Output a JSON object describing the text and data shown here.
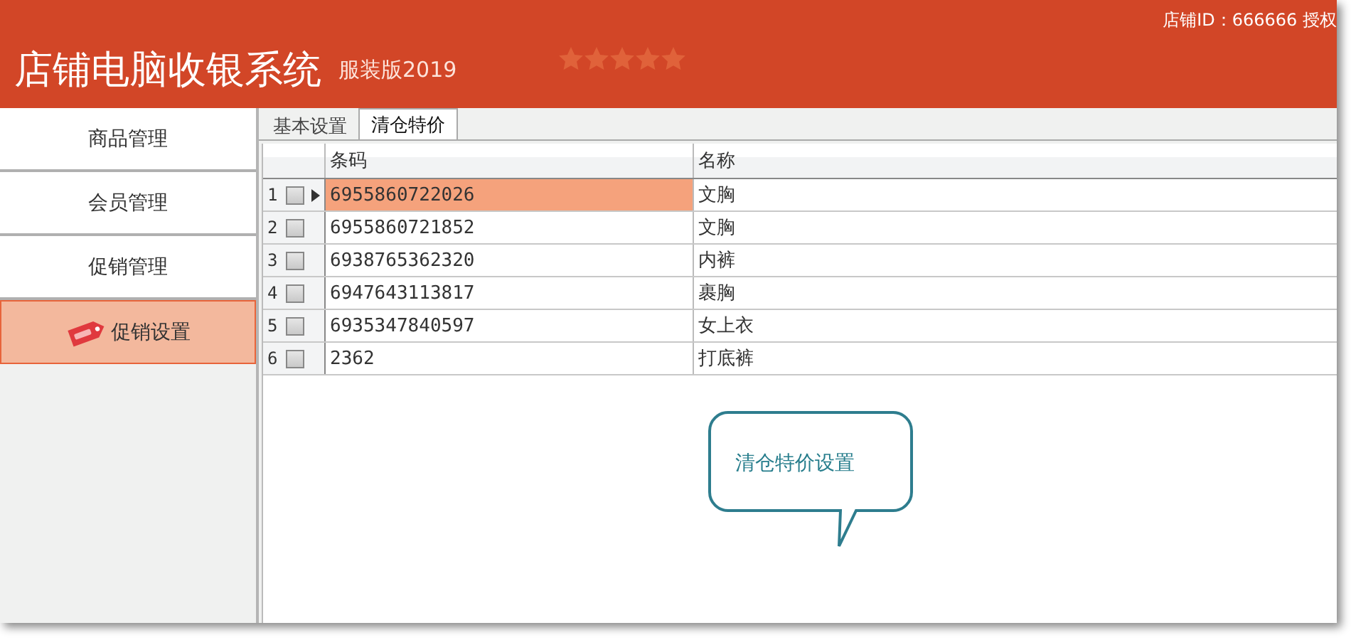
{
  "header": {
    "title": "店铺电脑收银系统",
    "edition": "服装版2019",
    "stars": 5,
    "store_info": "店铺ID：666666 授权"
  },
  "sidebar": {
    "items": [
      {
        "label": "商品管理",
        "selected": false,
        "kind": "plain"
      },
      {
        "label": "会员管理",
        "selected": false,
        "kind": "plain"
      },
      {
        "label": "促销管理",
        "selected": false,
        "kind": "plain"
      },
      {
        "label": "促销设置",
        "selected": true,
        "kind": "sale"
      }
    ]
  },
  "tabs": [
    {
      "label": "基本设置",
      "selected": false
    },
    {
      "label": "清仓特价",
      "selected": true
    }
  ],
  "table": {
    "columns": [
      "条码",
      "名称"
    ],
    "rows": [
      {
        "index": "1",
        "checked": false,
        "selected": true,
        "barcode": "6955860722026",
        "name": "文胸"
      },
      {
        "index": "2",
        "checked": false,
        "selected": false,
        "barcode": "6955860721852",
        "name": "文胸"
      },
      {
        "index": "3",
        "checked": false,
        "selected": false,
        "barcode": "6938765362320",
        "name": "内裤"
      },
      {
        "index": "4",
        "checked": false,
        "selected": false,
        "barcode": "6947643113817",
        "name": "裹胸"
      },
      {
        "index": "5",
        "checked": false,
        "selected": false,
        "barcode": "6935347840597",
        "name": "女上衣"
      },
      {
        "index": "6",
        "checked": false,
        "selected": false,
        "barcode": "2362",
        "name": "打底裤"
      }
    ]
  },
  "callout": {
    "text": "清仓特价设置"
  }
}
